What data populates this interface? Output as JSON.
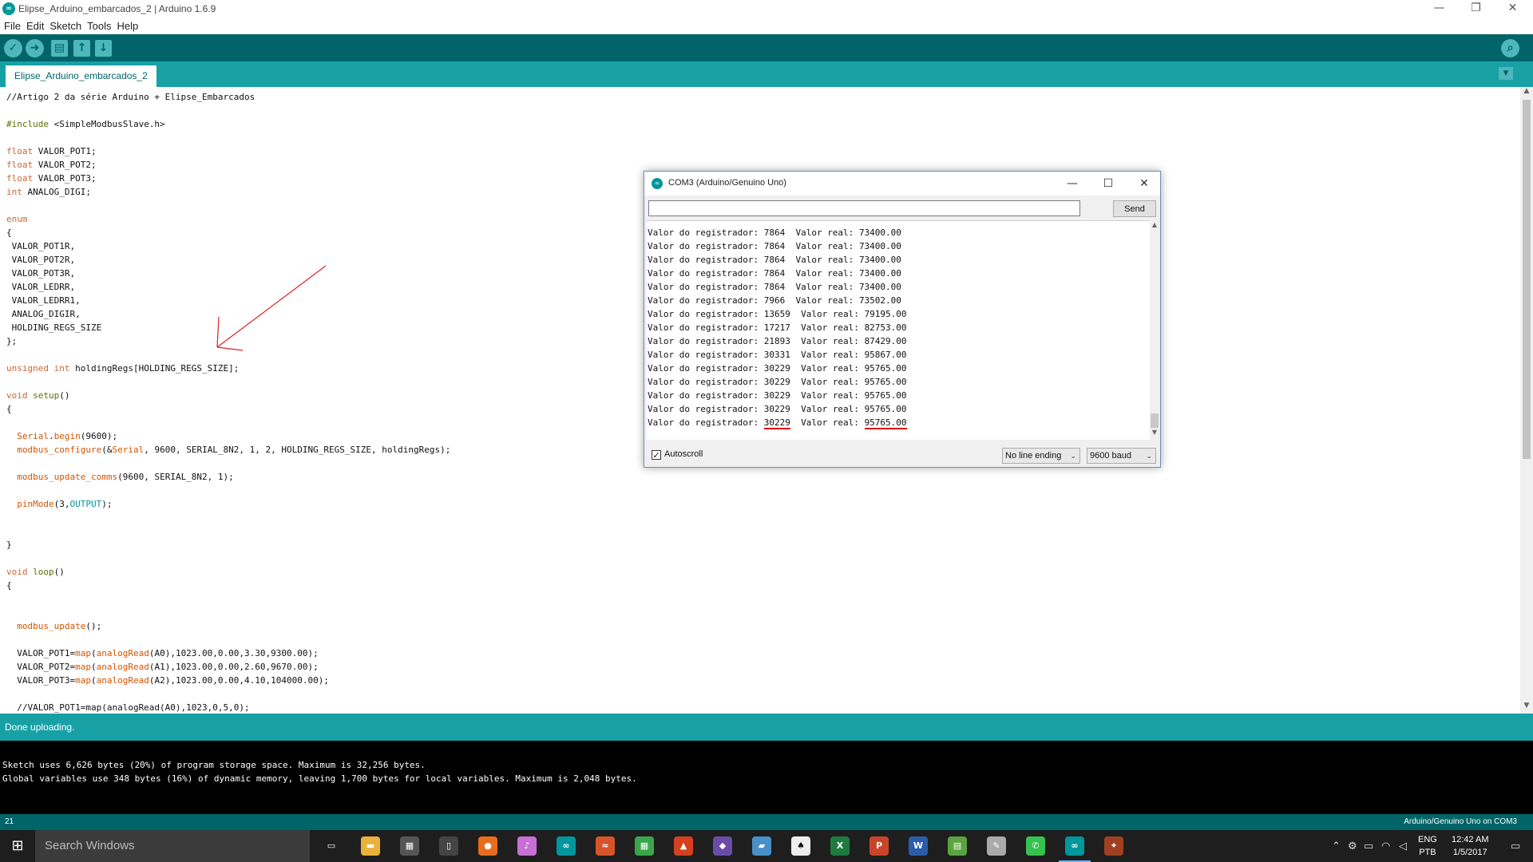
{
  "window": {
    "title": "Elipse_Arduino_embarcados_2 | Arduino 1.6.9",
    "app_icon_text": "∞",
    "controls": [
      "—",
      "❐",
      "✕"
    ]
  },
  "menu": [
    "File",
    "Edit",
    "Sketch",
    "Tools",
    "Help"
  ],
  "toolbar": {
    "verify": "✓",
    "upload": "➜",
    "new": "▤",
    "open": "↑",
    "save": "↓",
    "serial_monitor": "⌕"
  },
  "tabs": [
    {
      "label": "Elipse_Arduino_embarcados_2"
    }
  ],
  "tab_menu": "▼",
  "editor": {
    "code": [
      [
        {
          "t": "//Artigo 2 da série Arduino + Elipse_Embarcados"
        }
      ],
      [
        {
          "t": ""
        }
      ],
      [
        {
          "t": "#include",
          "c": "kw-ctl"
        },
        {
          "t": " <SimpleModbusSlave.h>"
        }
      ],
      [
        {
          "t": ""
        }
      ],
      [
        {
          "t": "float",
          "c": "kw-type"
        },
        {
          "t": " VALOR_POT1;"
        }
      ],
      [
        {
          "t": "float",
          "c": "kw-type"
        },
        {
          "t": " VALOR_POT2;"
        }
      ],
      [
        {
          "t": "float",
          "c": "kw-type"
        },
        {
          "t": " VALOR_POT3;"
        }
      ],
      [
        {
          "t": "int",
          "c": "kw-type"
        },
        {
          "t": " ANALOG_DIGI;"
        }
      ],
      [
        {
          "t": ""
        }
      ],
      [
        {
          "t": "enum",
          "c": "kw-type"
        }
      ],
      [
        {
          "t": "{"
        }
      ],
      [
        {
          "t": " VALOR_POT1R,"
        }
      ],
      [
        {
          "t": " VALOR_POT2R,"
        }
      ],
      [
        {
          "t": " VALOR_POT3R,"
        }
      ],
      [
        {
          "t": " VALOR_LEDRR,"
        }
      ],
      [
        {
          "t": " VALOR_LEDRR1,"
        }
      ],
      [
        {
          "t": " ANALOG_DIGIR,"
        }
      ],
      [
        {
          "t": " HOLDING_REGS_SIZE"
        }
      ],
      [
        {
          "t": "};"
        }
      ],
      [
        {
          "t": ""
        }
      ],
      [
        {
          "t": "unsigned",
          "c": "kw-type"
        },
        {
          "t": " "
        },
        {
          "t": "int",
          "c": "kw-type"
        },
        {
          "t": " holdingRegs[HOLDING_REGS_SIZE];"
        }
      ],
      [
        {
          "t": ""
        }
      ],
      [
        {
          "t": "void",
          "c": "kw-type"
        },
        {
          "t": " "
        },
        {
          "t": "setup",
          "c": "kw-ctl"
        },
        {
          "t": "()"
        }
      ],
      [
        {
          "t": "{"
        }
      ],
      [
        {
          "t": ""
        }
      ],
      [
        {
          "t": "  "
        },
        {
          "t": "Serial",
          "c": "fn"
        },
        {
          "t": "."
        },
        {
          "t": "begin",
          "c": "fn"
        },
        {
          "t": "(9600);"
        }
      ],
      [
        {
          "t": "  "
        },
        {
          "t": "modbus_configure",
          "c": "fn"
        },
        {
          "t": "(&"
        },
        {
          "t": "Serial",
          "c": "fn"
        },
        {
          "t": ", 9600, SERIAL_8N2, 1, 2, HOLDING_REGS_SIZE, holdingRegs);"
        }
      ],
      [
        {
          "t": ""
        }
      ],
      [
        {
          "t": "  "
        },
        {
          "t": "modbus_update_comms",
          "c": "fn"
        },
        {
          "t": "(9600, SERIAL_8N2, 1);"
        }
      ],
      [
        {
          "t": ""
        }
      ],
      [
        {
          "t": "  "
        },
        {
          "t": "pinMode",
          "c": "fn"
        },
        {
          "t": "(3,"
        },
        {
          "t": "OUTPUT",
          "c": "const"
        },
        {
          "t": ");"
        }
      ],
      [
        {
          "t": ""
        }
      ],
      [
        {
          "t": ""
        }
      ],
      [
        {
          "t": "}"
        }
      ],
      [
        {
          "t": ""
        }
      ],
      [
        {
          "t": "void",
          "c": "kw-type"
        },
        {
          "t": " "
        },
        {
          "t": "loop",
          "c": "kw-ctl"
        },
        {
          "t": "()"
        }
      ],
      [
        {
          "t": "{"
        }
      ],
      [
        {
          "t": ""
        }
      ],
      [
        {
          "t": ""
        }
      ],
      [
        {
          "t": "  "
        },
        {
          "t": "modbus_update",
          "c": "fn"
        },
        {
          "t": "();"
        }
      ],
      [
        {
          "t": ""
        }
      ],
      [
        {
          "t": "  VALOR_POT1="
        },
        {
          "t": "map",
          "c": "fn"
        },
        {
          "t": "("
        },
        {
          "t": "analogRead",
          "c": "fn"
        },
        {
          "t": "(A0),1023.00,0.00,3.30,9300.00);"
        }
      ],
      [
        {
          "t": "  VALOR_POT2="
        },
        {
          "t": "map",
          "c": "fn"
        },
        {
          "t": "("
        },
        {
          "t": "analogRead",
          "c": "fn"
        },
        {
          "t": "(A1),1023.00,0.00,2.60,9670.00);"
        }
      ],
      [
        {
          "t": "  VALOR_POT3="
        },
        {
          "t": "map",
          "c": "fn"
        },
        {
          "t": "("
        },
        {
          "t": "analogRead",
          "c": "fn"
        },
        {
          "t": "(A2),1023.00,0.00,4.10,104000.00);"
        }
      ],
      [
        {
          "t": ""
        }
      ],
      [
        {
          "t": "  //VALOR_POT1=map(analogRead(A0),1023,0,5,0);"
        }
      ]
    ]
  },
  "status": {
    "message": "Done uploading."
  },
  "console": {
    "lines": [
      "Sketch uses 6,626 bytes (20%) of program storage space. Maximum is 32,256 bytes.",
      "Global variables use 348 bytes (16%) of dynamic memory, leaving 1,700 bytes for local variables. Maximum is 2,048 bytes."
    ]
  },
  "footer": {
    "line_number": "21",
    "board": "Arduino/Genuino Uno on COM3"
  },
  "serial_monitor": {
    "title": "COM3 (Arduino/Genuino Uno)",
    "input_value": "",
    "send_label": "Send",
    "label_reg": "Valor do registrador: ",
    "label_real": "Valor real: ",
    "rows": [
      {
        "reg": "7864",
        "real": "73400.00"
      },
      {
        "reg": "7864",
        "real": "73400.00"
      },
      {
        "reg": "7864",
        "real": "73400.00"
      },
      {
        "reg": "7864",
        "real": "73400.00"
      },
      {
        "reg": "7864",
        "real": "73400.00"
      },
      {
        "reg": "7966",
        "real": "73502.00"
      },
      {
        "reg": "13659",
        "real": "79195.00"
      },
      {
        "reg": "17217",
        "real": "82753.00"
      },
      {
        "reg": "21893",
        "real": "87429.00"
      },
      {
        "reg": "30331",
        "real": "95867.00"
      },
      {
        "reg": "30229",
        "real": "95765.00"
      },
      {
        "reg": "30229",
        "real": "95765.00"
      },
      {
        "reg": "30229",
        "real": "95765.00"
      },
      {
        "reg": "30229",
        "real": "95765.00"
      },
      {
        "reg": "30229",
        "real": "95765.00",
        "underline": true
      }
    ],
    "autoscroll_label": "Autoscroll",
    "autoscroll_checked": true,
    "line_ending": "No line ending",
    "baud": "9600 baud"
  },
  "taskbar": {
    "search_placeholder": "Search Windows",
    "apps": [
      {
        "name": "task-view-icon",
        "glyph": "▭",
        "color": "#1e1e1e"
      },
      {
        "name": "file-explorer-icon",
        "glyph": "▬",
        "color": "#e8b23a"
      },
      {
        "name": "calculator-icon",
        "glyph": "▦",
        "color": "#555555"
      },
      {
        "name": "phone-icon",
        "glyph": "▯",
        "color": "#444444"
      },
      {
        "name": "firefox-icon",
        "glyph": "●",
        "color": "#e86c1c"
      },
      {
        "name": "itunes-icon",
        "glyph": "♪",
        "color": "#c86fd6"
      },
      {
        "name": "arduino-icon",
        "glyph": "∞",
        "color": "#00979c"
      },
      {
        "name": "cloud-app-icon",
        "glyph": "≈",
        "color": "#d9532a"
      },
      {
        "name": "store-icon",
        "glyph": "▦",
        "color": "#3aa64a"
      },
      {
        "name": "matlab-icon",
        "glyph": "▲",
        "color": "#d5401f"
      },
      {
        "name": "visual-studio-icon",
        "glyph": "◆",
        "color": "#6a4ca8"
      },
      {
        "name": "notes-icon",
        "glyph": "▰",
        "color": "#4a90c8"
      },
      {
        "name": "cards-game-icon",
        "glyph": "♠",
        "color": "#eeeeee"
      },
      {
        "name": "excel-icon",
        "glyph": "X",
        "color": "#1f7a3e"
      },
      {
        "name": "powerpoint-icon",
        "glyph": "P",
        "color": "#c9452a"
      },
      {
        "name": "word-icon",
        "glyph": "W",
        "color": "#2a5caa"
      },
      {
        "name": "notepad-icon",
        "glyph": "▤",
        "color": "#5aa440"
      },
      {
        "name": "tools-icon",
        "glyph": "✎",
        "color": "#aaaaaa"
      },
      {
        "name": "whatsapp-icon",
        "glyph": "✆",
        "color": "#35c24f"
      },
      {
        "name": "arduino-active-icon",
        "glyph": "∞",
        "color": "#00979c"
      },
      {
        "name": "app-extra-icon",
        "glyph": "✦",
        "color": "#a04020"
      }
    ],
    "tray": {
      "lang_top": "ENG",
      "lang_bottom": "PTB",
      "time": "12:42 AM",
      "date": "1/5/2017"
    }
  }
}
